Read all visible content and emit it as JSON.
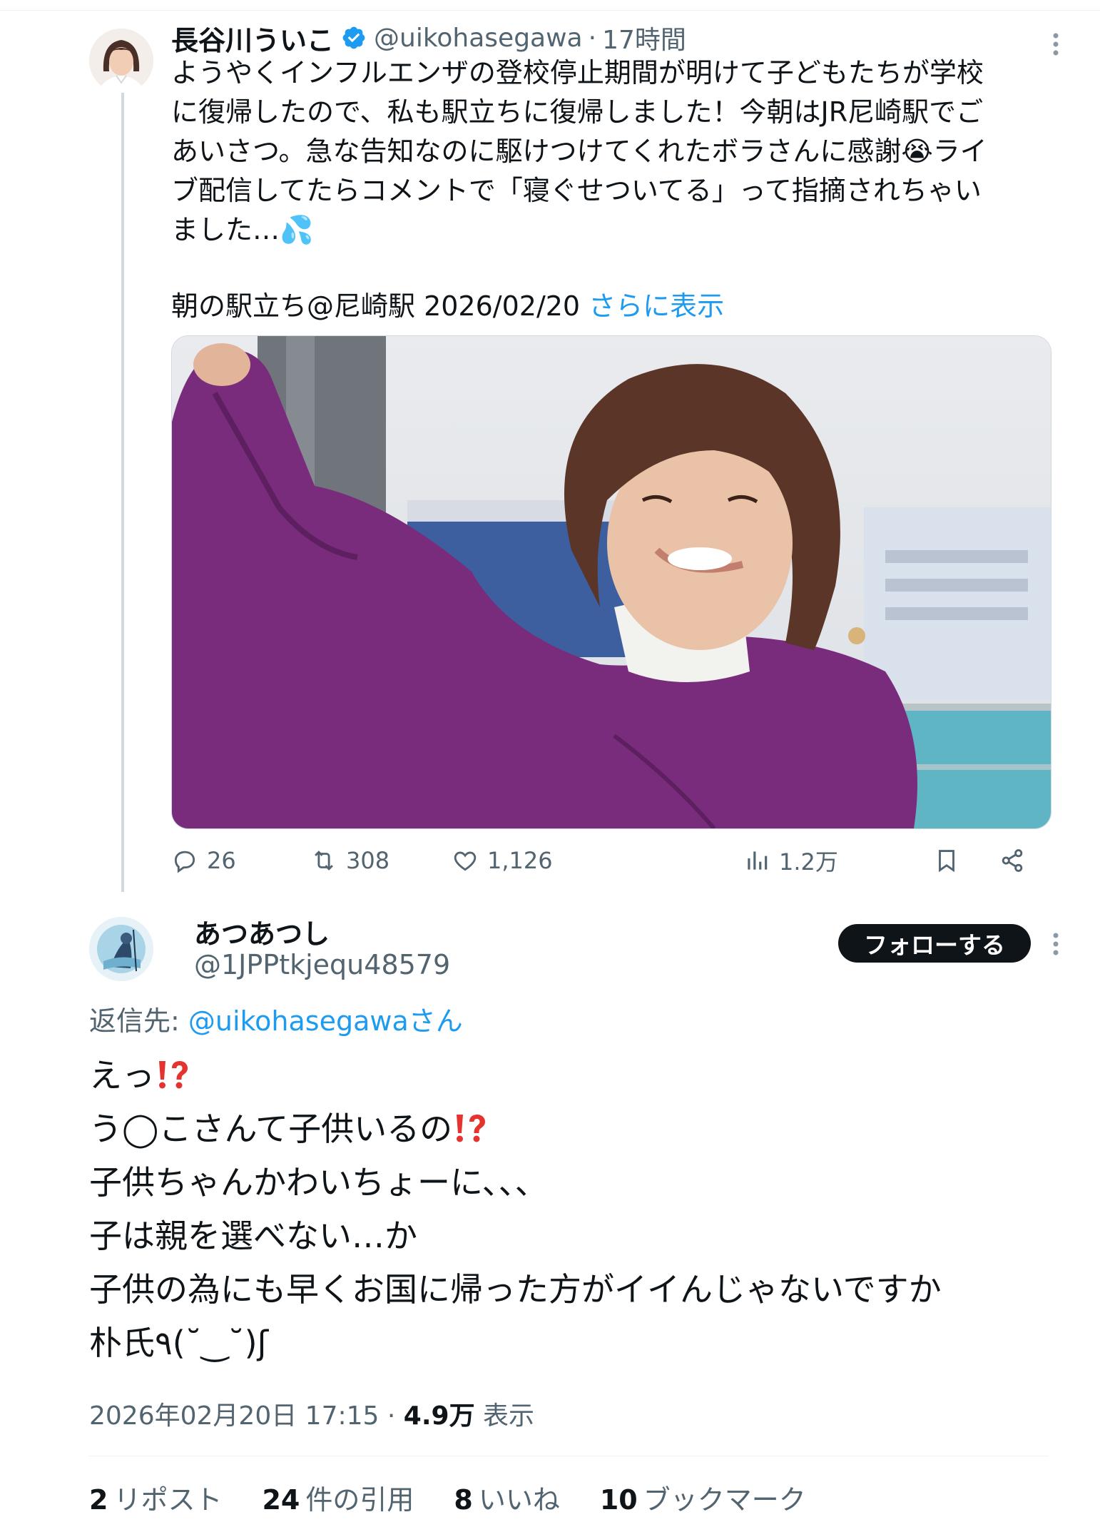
{
  "tweet": {
    "author_name": "長谷川ういこ",
    "author_handle": "@uikohasegawa",
    "separator": "·",
    "time": "17時間",
    "text": "ようやくインフルエンザの登校停止期間が明けて子どもたちが学校\nに復帰したので、私も駅立ちに復帰しました！今朝はJR尼崎駅でご\nあいさつ。急な告知なのに駆けつけてくれたボラさんに感謝😭ライ\nブ配信してたらコメントで「寝ぐせついてる」って指摘されちゃい\nました…💦",
    "footer_line": "朝の駅立ち@尼崎駅 2026/02/20",
    "show_more": "さらに表示",
    "actions": {
      "replies": "26",
      "retweets": "308",
      "likes": "1,126",
      "views": "1.2万"
    }
  },
  "reply": {
    "author_name": "あつあつし",
    "author_handle": "@1JPPtkjequ48579",
    "follow_label": "フォローする",
    "replying_prefix": "返信先: ",
    "replying_mention": "@uikohasegawaさん",
    "lines": [
      "えっ",
      "う◯こさんて子供いるの",
      "子供ちゃんかわいちょーに、、、",
      "子は親を選べない…か",
      "子供の為にも早くお国に帰った方がイイんじゃないですか",
      "朴氏٩(˘‿˘)ʃ"
    ],
    "timestamp": "2026年02月20日 17:15",
    "meta_separator": "·",
    "views_count": "4.9万",
    "views_label": "表示",
    "stats": {
      "reposts_count": "2",
      "reposts_label": "リポスト",
      "quotes_count": "24",
      "quotes_label": "件の引用",
      "likes_count": "8",
      "likes_label": "いいね",
      "bookmarks_count": "10",
      "bookmarks_label": "ブックマーク"
    }
  },
  "colors": {
    "text": "#0f1419",
    "secondary": "#536471",
    "link": "#1d9bf0",
    "follow_button": "#0f1419",
    "jacket": "#7a2c7c"
  },
  "icons": [
    "verified-badge-icon",
    "more-icon",
    "reply-icon",
    "retweet-icon",
    "like-icon",
    "views-icon",
    "bookmark-icon",
    "share-icon",
    "exclamation-question-icon"
  ]
}
